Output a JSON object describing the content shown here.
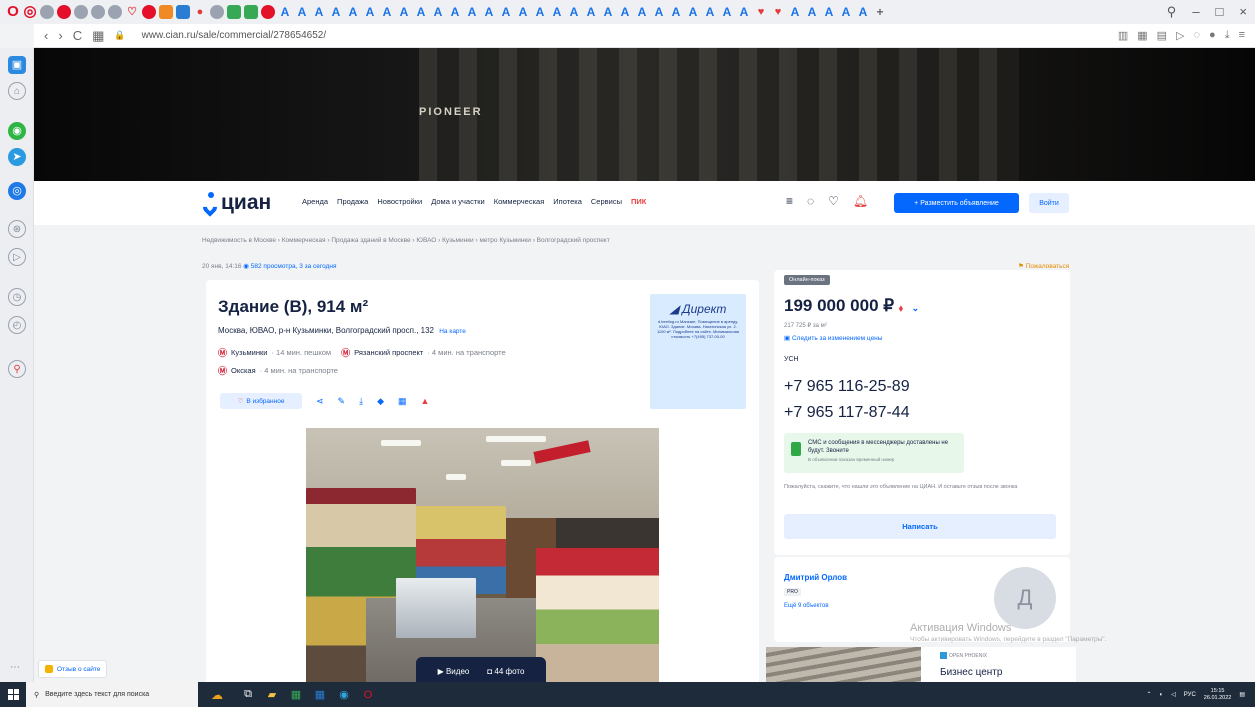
{
  "browser": {
    "url": "www.cian.ru/sale/commercial/278654652/",
    "nav": {
      "back": "‹",
      "forward": "›",
      "reload": "C",
      "tabs_grid": "▦"
    },
    "window_controls": {
      "search": "⚲",
      "minimize": "–",
      "maximize": "□",
      "close": "×"
    }
  },
  "site": {
    "logo_text": "циан",
    "nav": [
      "Аренда",
      "Продажа",
      "Новостройки",
      "Дома и участки",
      "Коммерческая",
      "Ипотека",
      "Сервисы",
      "ПИК"
    ],
    "post_button": "+ Разместить объявление",
    "login_button": "Войти"
  },
  "banner": {
    "logo": "PIONEER"
  },
  "breadcrumbs": "Недвижимость в Москве › Коммерческая › Продажа зданий в Москве › ЮВАО › Кузьминки › метро Кузьминки › Волгоградский проспект",
  "meta": {
    "date": "20 янв, 14:16",
    "views": "582 просмотра, 3 за сегодня",
    "complaint": "Пожаловаться"
  },
  "listing": {
    "title": "Здание (В), 914 м²",
    "address": "Москва, ЮВАО, р-н Кузьминки, Волгоградский просп., 132",
    "map_link": "На карте",
    "metro": [
      {
        "name": "Кузьминки",
        "time": "· 14 мин. пешком"
      },
      {
        "name": "Рязанский проспект",
        "time": "· 4 мин. на транспорте"
      },
      {
        "name": "Окская",
        "time": "· 4 мин. на транспорте"
      }
    ],
    "favorite": "В избранное",
    "media": {
      "video": "Видео",
      "photos": "44 фото"
    }
  },
  "ad": {
    "brand": "Директ",
    "text": "d.beeling.ru Магазин. Помещение в аренду. ЮАО. Здание. Москва. Нагатинская ул. 2. 1100 м². Подробнее на сайте. Минимальная стоимость +7(495) 737-00-00"
  },
  "offer": {
    "badge": "Онлайн-показ",
    "price": "199 000 000 ₽",
    "price_per_sqm": "217 725 ₽ за м²",
    "follow": "Следить за изменением цены",
    "tax": "УСН",
    "phones": [
      "+7 965 116-25-89",
      "+7 965 117-87-44"
    ],
    "sms_title": "СМС и сообщения в мессенджеры доставлены не будут. Звоните",
    "sms_sub": "В объявлении показан временный номер",
    "note": "Пожалуйста, скажите, что нашли это объявление на ЦИАН. И оставьте отзыв после звонка",
    "note_link": "оставьте отзыв после звонка",
    "write_button": "Написать"
  },
  "agent": {
    "name": "Дмитрий Орлов",
    "badge": "PRO",
    "objects": "Ещё 9 объектов",
    "avatar_letter": "Д"
  },
  "biz": {
    "pill": "OPEN PHOENIX",
    "title": "Бизнес центр"
  },
  "activation": {
    "title": "Активация Windows",
    "sub": "Чтобы активировать Windows, перейдите в раздел \"Параметры\"."
  },
  "feedback": "Отзыв о сайте",
  "taskbar": {
    "search_placeholder": "Введите здесь текст для поиска",
    "lang": "РУС",
    "time": "15:15",
    "date": "26.01.2022"
  }
}
